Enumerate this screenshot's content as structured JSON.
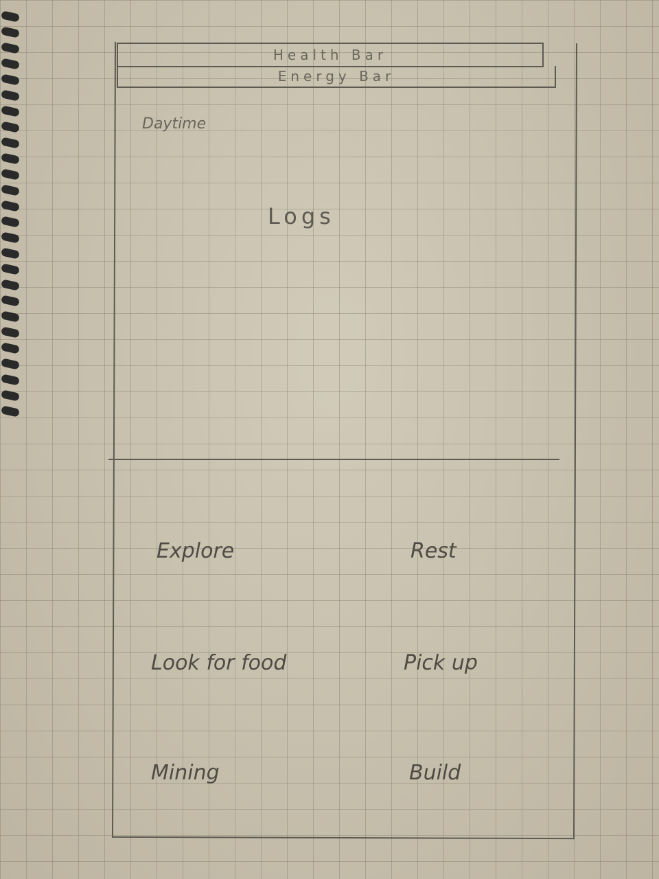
{
  "header": {
    "health_bar_label": "Health Bar",
    "energy_bar_label": "Energy Bar"
  },
  "status": {
    "time_of_day": "Daytime"
  },
  "logs": {
    "label": "Logs"
  },
  "actions": [
    {
      "label": "Explore"
    },
    {
      "label": "Rest"
    },
    {
      "label": "Look for food"
    },
    {
      "label": "Pick up"
    },
    {
      "label": "Mining"
    },
    {
      "label": "Build"
    }
  ]
}
